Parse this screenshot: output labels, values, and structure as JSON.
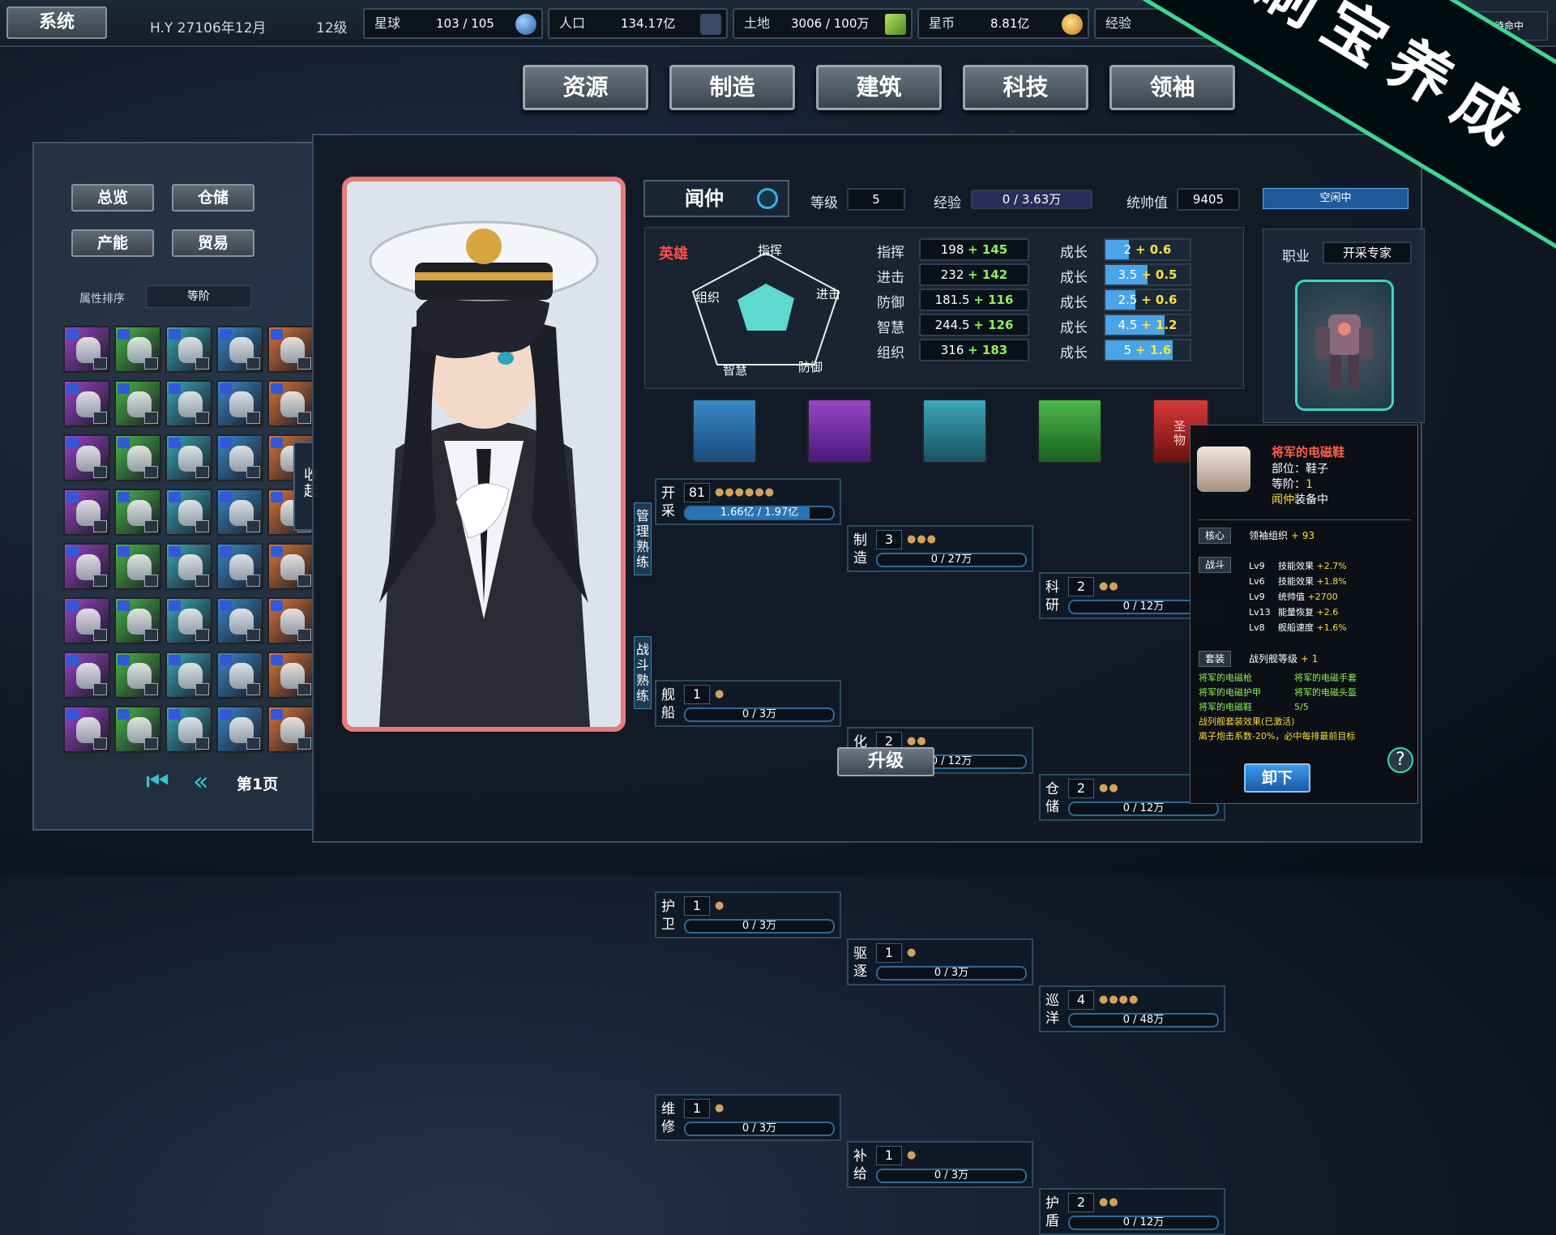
{
  "top": {
    "system_label": "系统",
    "date": "H.Y 27106年12月",
    "level": "12级",
    "planet_label": "星球",
    "planet_value": "103 / 105",
    "population_label": "人口",
    "population_value": "134.17亿",
    "land_label": "土地",
    "land_value": "3006 / 100万",
    "coin_label": "星币",
    "coin_value": "8.81亿",
    "exp_label": "经验",
    "fleet_status": "舰队待命中"
  },
  "main_tabs": [
    "资源",
    "制造",
    "建筑",
    "科技",
    "领袖"
  ],
  "banner": "刷宝养成",
  "left": {
    "buttons": [
      "总览",
      "仓储",
      "产能",
      "贸易"
    ],
    "sort_label": "属性排序",
    "sort_value": "等阶",
    "page_label": "第1页",
    "collapse_label": "收起"
  },
  "leader": {
    "name": "闻仲",
    "level_label": "等级",
    "level": "5",
    "exp_label": "经验",
    "exp": "0 / 3.63万",
    "command_label": "统帅值",
    "command": "9405",
    "hero_tag": "英雄",
    "pentagon": [
      "指挥",
      "进击",
      "防御",
      "智慧",
      "组织"
    ],
    "stats": [
      {
        "name": "指挥",
        "base": "198",
        "bonus": "+ 145",
        "grow_label": "成长",
        "grow": "2",
        "grow_bonus": "+ 0.6",
        "grow_pct": 28
      },
      {
        "name": "进击",
        "base": "232",
        "bonus": "+ 142",
        "grow_label": "成长",
        "grow": "3.5",
        "grow_bonus": "+ 0.5",
        "grow_pct": 50
      },
      {
        "name": "防御",
        "base": "181.5",
        "bonus": "+ 116",
        "grow_label": "成长",
        "grow": "2.5",
        "grow_bonus": "+ 0.6",
        "grow_pct": 36
      },
      {
        "name": "智慧",
        "base": "244.5",
        "bonus": "+ 126",
        "grow_label": "成长",
        "grow": "4.5",
        "grow_bonus": "+ 1.2",
        "grow_pct": 70
      },
      {
        "name": "组织",
        "base": "316",
        "bonus": "+ 183",
        "grow_label": "成长",
        "grow": "5",
        "grow_bonus": "+ 1.6",
        "grow_pct": 80
      }
    ],
    "relic_label": "圣物",
    "job_label": "职业",
    "job": "开采专家",
    "idle_label": "空闲中"
  },
  "skills": {
    "manage_caption": "管理熟练",
    "battle_caption": "战斗熟练",
    "items": [
      {
        "name": "开采",
        "lv": "81",
        "progress": "1.66亿 / 1.97亿",
        "gems": "●●●●●●",
        "pct": 84
      },
      {
        "name": "制造",
        "lv": "3",
        "progress": "0 / 27万",
        "gems": "●●●",
        "pct": 0
      },
      {
        "name": "科研",
        "lv": "2",
        "progress": "0 / 12万",
        "gems": "●●",
        "pct": 0
      },
      {
        "name": "舰船",
        "lv": "1",
        "progress": "0 / 3万",
        "gems": "●",
        "pct": 0
      },
      {
        "name": "化工",
        "lv": "2",
        "progress": "0 / 12万",
        "gems": "●●",
        "pct": 0
      },
      {
        "name": "仓储",
        "lv": "2",
        "progress": "0 / 12万",
        "gems": "●●",
        "pct": 0
      },
      {
        "name": "护卫",
        "lv": "1",
        "progress": "0 / 3万",
        "gems": "●",
        "pct": 0
      },
      {
        "name": "驱逐",
        "lv": "1",
        "progress": "0 / 3万",
        "gems": "●",
        "pct": 0
      },
      {
        "name": "巡洋",
        "lv": "4",
        "progress": "0 / 48万",
        "gems": "●●●●",
        "pct": 0
      },
      {
        "name": "维修",
        "lv": "1",
        "progress": "0 / 3万",
        "gems": "●",
        "pct": 0
      },
      {
        "name": "补给",
        "lv": "1",
        "progress": "0 / 3万",
        "gems": "●",
        "pct": 0
      },
      {
        "name": "护盾",
        "lv": "2",
        "progress": "0 / 12万",
        "gems": "●●",
        "pct": 0
      }
    ]
  },
  "upgrade_label": "升级",
  "tooltip": {
    "title": "将军的电磁鞋",
    "slot": "部位：鞋子",
    "tier_label": "等阶：",
    "tier": "1",
    "owner": "闻仲",
    "equipped": "装备中",
    "core_tag": "核心",
    "core_text": "领袖组织",
    "core_val": "+ 93",
    "battle_tag": "战斗",
    "battle_lines": [
      {
        "lv": "Lv9",
        "text": "技能效果",
        "val": "+2.7%"
      },
      {
        "lv": "Lv6",
        "text": "技能效果",
        "val": "+1.8%"
      },
      {
        "lv": "Lv9",
        "text": "统帅值",
        "val": "+2700"
      },
      {
        "lv": "Lv13",
        "text": "能量恢复",
        "val": "+2.6"
      },
      {
        "lv": "Lv8",
        "text": "舰船速度",
        "val": "+1.6%"
      }
    ],
    "set_tag": "套装",
    "set_text": "战列舰等级",
    "set_val": "+ 1",
    "set_items": [
      "将军的电磁枪",
      "将军的电磁手套",
      "将军的电磁护甲",
      "将军的电磁头盔",
      "将军的电磁鞋"
    ],
    "set_count": "5/5",
    "set_effect_title": "战列舰套装效果(已激活)",
    "set_effect": "离子炮击系数-20%，必中每排最前目标",
    "unload_label": "卸下"
  },
  "help_label": "?"
}
